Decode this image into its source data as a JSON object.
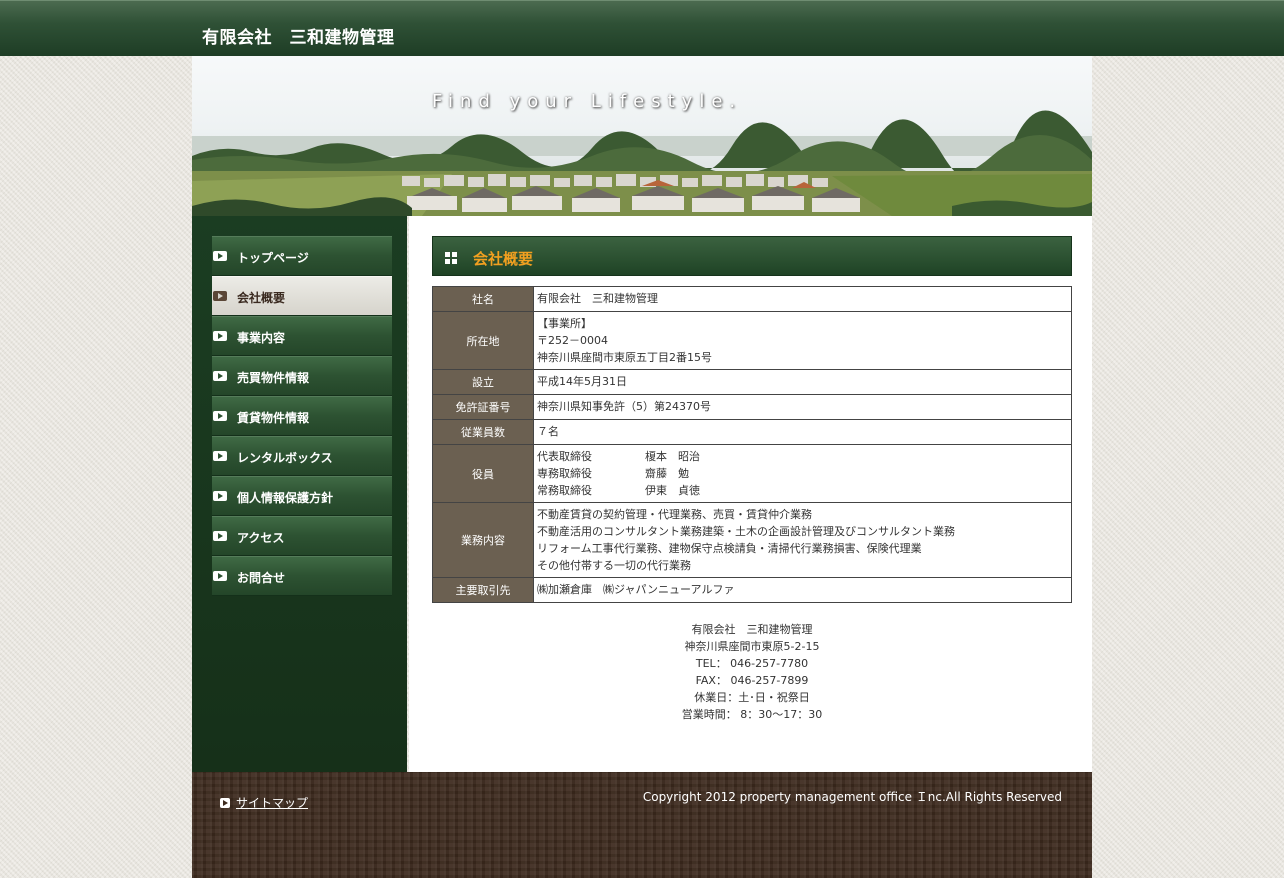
{
  "site": {
    "title": "有限会社　三和建物管理",
    "tagline": "Find your Lifestyle."
  },
  "nav": {
    "items": [
      {
        "label": "トップページ",
        "active": false
      },
      {
        "label": "会社概要",
        "active": true
      },
      {
        "label": "事業内容",
        "active": false
      },
      {
        "label": "売買物件情報",
        "active": false
      },
      {
        "label": "賃貸物件情報",
        "active": false
      },
      {
        "label": "レンタルボックス",
        "active": false
      },
      {
        "label": "個人情報保護方針",
        "active": false
      },
      {
        "label": "アクセス",
        "active": false
      },
      {
        "label": "お問合せ",
        "active": false
      }
    ]
  },
  "section": {
    "title": "会社概要"
  },
  "company": {
    "name_label": "社名",
    "name_value": "有限会社　三和建物管理",
    "address_label": "所在地",
    "address_lines": [
      "【事業所】",
      "〒252－0004",
      "神奈川県座間市東原五丁目2番15号"
    ],
    "founded_label": "設立",
    "founded_value": "平成14年5月31日",
    "license_label": "免許証番号",
    "license_value": "神奈川県知事免許（5）第24370号",
    "employees_label": "従業員数",
    "employees_value": "７名",
    "officers_label": "役員",
    "officers": [
      {
        "title": "代表取締役",
        "name": "榎本　昭治"
      },
      {
        "title": "専務取締役",
        "name": "齋藤　勉"
      },
      {
        "title": "常務取締役",
        "name": "伊東　貞徳"
      }
    ],
    "business_label": "業務内容",
    "business_lines": [
      "不動産賃貸の契約管理・代理業務、売買・賃貸仲介業務",
      "不動産活用のコンサルタント業務建築・土木の企画設計管理及びコンサルタント業務",
      "リフォーム工事代行業務、建物保守点検請負・清掃代行業務損害、保険代理業",
      "その他付帯する一切の代行業務"
    ],
    "clients_label": "主要取引先",
    "clients_value": "㈱加瀬倉庫　㈱ジャパンニューアルファ"
  },
  "footer_info": {
    "lines": [
      "有限会社　三和建物管理",
      "神奈川県座間市東原5-2-15",
      "TEL： 046‐257‐7780",
      "FAX： 046‐257‐7899",
      "休業日：土･日・祝祭日",
      "営業時間： 8：30〜17：30"
    ]
  },
  "bottom": {
    "sitemap_label": "サイトマップ",
    "copyright": "Copyright 2012 property management office Ｉnc.All Rights Reserved"
  },
  "colors": {
    "brand_green": "#2f5136",
    "accent_orange": "#f2a020",
    "table_header": "#6b6051",
    "footer_brown": "#3d2a1e"
  }
}
